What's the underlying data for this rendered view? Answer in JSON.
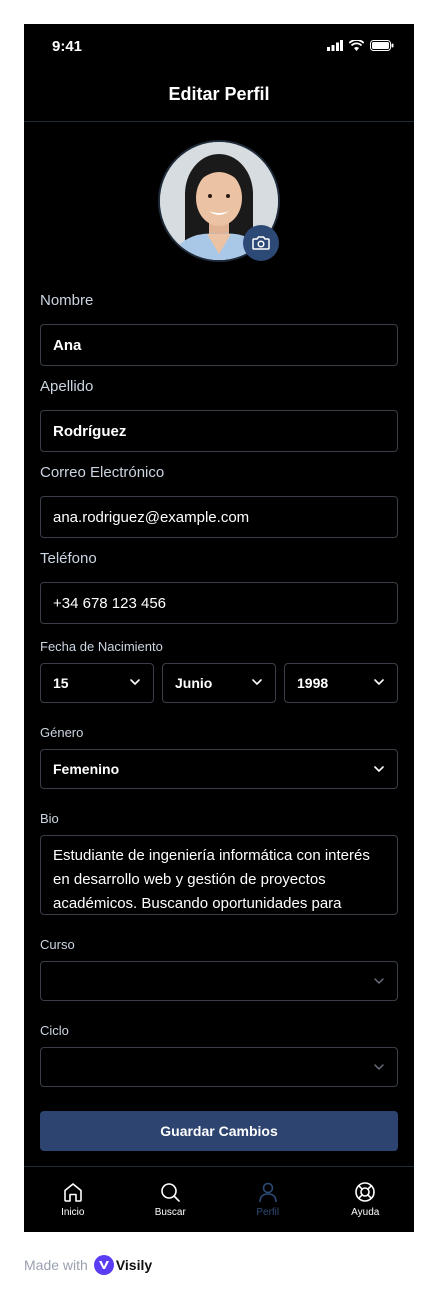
{
  "status": {
    "time": "9:41"
  },
  "header": {
    "title": "Editar Perfil"
  },
  "form": {
    "nombre": {
      "label": "Nombre",
      "value": "Ana"
    },
    "apellido": {
      "label": "Apellido",
      "value": "Rodríguez"
    },
    "correo": {
      "label": "Correo Electrónico",
      "value": "ana.rodriguez@example.com"
    },
    "telefono": {
      "label": "Teléfono",
      "value": "+34 678 123 456"
    },
    "fecha": {
      "label": "Fecha de Nacimiento",
      "dia": "15",
      "mes": "Junio",
      "anio": "1998"
    },
    "genero": {
      "label": "Género",
      "value": "Femenino"
    },
    "bio": {
      "label": "Bio",
      "value": "Estudiante de ingeniería informática con interés en desarrollo web y gestión de proyectos académicos. Buscando oportunidades para"
    },
    "curso": {
      "label": "Curso",
      "value": ""
    },
    "ciclo": {
      "label": "Ciclo",
      "value": ""
    },
    "save_label": "Guardar Cambios"
  },
  "tabs": [
    {
      "label": "Inicio",
      "icon": "home-icon"
    },
    {
      "label": "Buscar",
      "icon": "search-icon"
    },
    {
      "label": "Perfil",
      "icon": "user-icon",
      "active": true
    },
    {
      "label": "Ayuda",
      "icon": "lifebuoy-icon"
    }
  ],
  "footer": {
    "made_with": "Made with",
    "brand": "Visily"
  },
  "colors": {
    "background": "#000000",
    "accent": "#2d4a76",
    "button": "#2d4470",
    "border": "#3a3f47"
  }
}
